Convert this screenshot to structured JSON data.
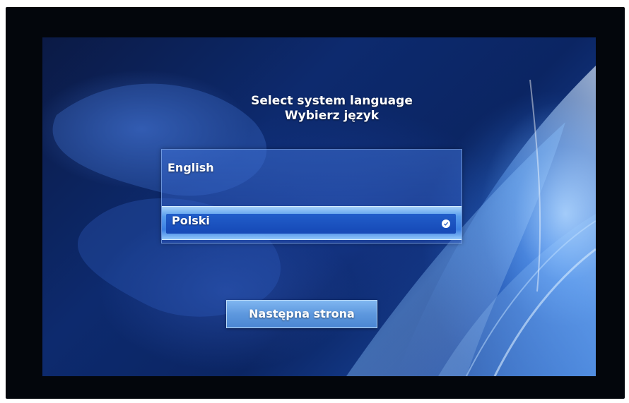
{
  "title": {
    "line1": "Select system language",
    "line2": "Wybierz język"
  },
  "languages": {
    "items": [
      {
        "label": "English",
        "selected": false
      },
      {
        "label": "Polski",
        "selected": true
      }
    ],
    "selected_icon": "check-icon"
  },
  "next_button": {
    "label": "Następna strona"
  },
  "colors": {
    "bezel": "#03060c",
    "background_base": "#0d2a6e",
    "highlight": "#5e98de",
    "text": "#ffffff"
  }
}
